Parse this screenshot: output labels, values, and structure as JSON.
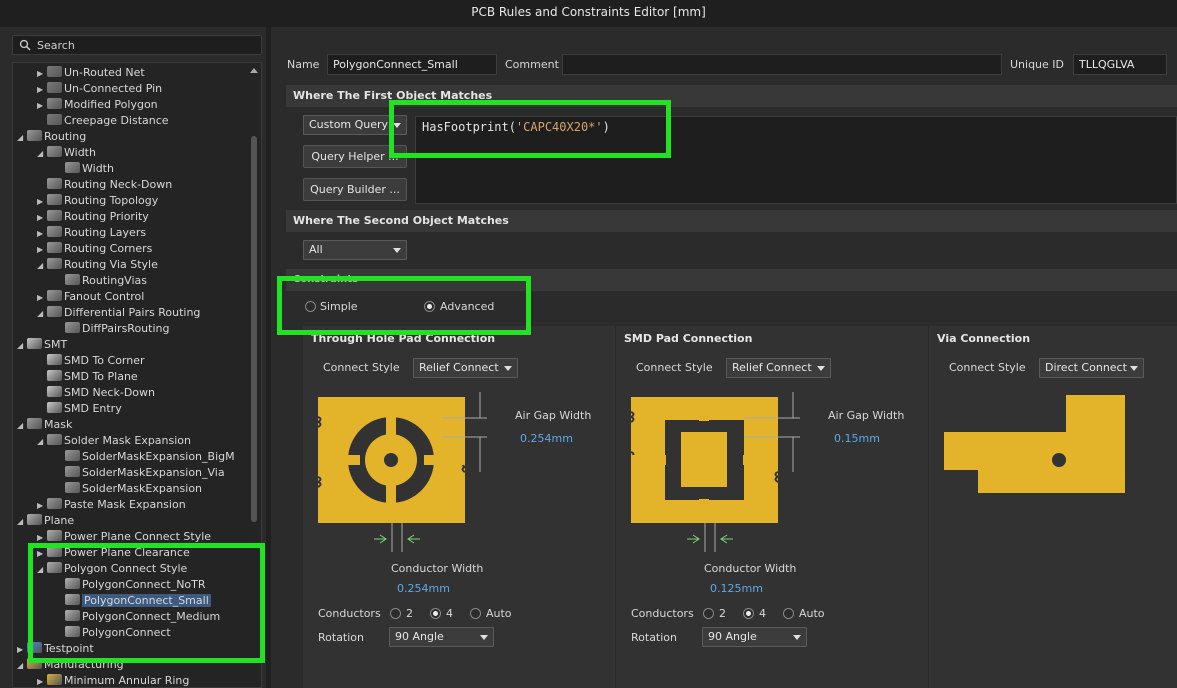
{
  "window": {
    "title": "PCB Rules and Constraints Editor [mm]"
  },
  "search": {
    "label": "Search"
  },
  "tree": {
    "items": [
      {
        "label": "Un-Routed Net",
        "arrow": "▶"
      },
      {
        "label": "Un-Connected Pin",
        "arrow": "▶"
      },
      {
        "label": "Modified Polygon",
        "arrow": "▶"
      },
      {
        "label": "Creepage Distance",
        "arrow": ""
      },
      {
        "label": "Routing",
        "arrow": "◢"
      },
      {
        "label": "Width",
        "arrow": "◢"
      },
      {
        "label": "Width",
        "arrow": ""
      },
      {
        "label": "Routing Neck-Down",
        "arrow": ""
      },
      {
        "label": "Routing Topology",
        "arrow": "▶"
      },
      {
        "label": "Routing Priority",
        "arrow": "▶"
      },
      {
        "label": "Routing Layers",
        "arrow": "▶"
      },
      {
        "label": "Routing Corners",
        "arrow": "▶"
      },
      {
        "label": "Routing Via Style",
        "arrow": "◢"
      },
      {
        "label": "RoutingVias",
        "arrow": ""
      },
      {
        "label": "Fanout Control",
        "arrow": "▶"
      },
      {
        "label": "Differential Pairs Routing",
        "arrow": "◢"
      },
      {
        "label": "DiffPairsRouting",
        "arrow": ""
      },
      {
        "label": "SMT",
        "arrow": "◢"
      },
      {
        "label": "SMD To Corner",
        "arrow": ""
      },
      {
        "label": "SMD To Plane",
        "arrow": ""
      },
      {
        "label": "SMD Neck-Down",
        "arrow": ""
      },
      {
        "label": "SMD Entry",
        "arrow": ""
      },
      {
        "label": "Mask",
        "arrow": "◢"
      },
      {
        "label": "Solder Mask Expansion",
        "arrow": "◢"
      },
      {
        "label": "SolderMaskExpansion_BigM",
        "arrow": ""
      },
      {
        "label": "SolderMaskExpansion_Via",
        "arrow": ""
      },
      {
        "label": "SolderMaskExpansion",
        "arrow": ""
      },
      {
        "label": "Paste Mask Expansion",
        "arrow": "▶"
      },
      {
        "label": "Plane",
        "arrow": "◢"
      },
      {
        "label": "Power Plane Connect Style",
        "arrow": "▶"
      },
      {
        "label": "Power Plane Clearance",
        "arrow": "▶"
      },
      {
        "label": "Polygon Connect Style",
        "arrow": "◢"
      },
      {
        "label": "PolygonConnect_NoTR",
        "arrow": ""
      },
      {
        "label": "PolygonConnect_Small",
        "arrow": ""
      },
      {
        "label": "PolygonConnect_Medium",
        "arrow": ""
      },
      {
        "label": "PolygonConnect",
        "arrow": ""
      },
      {
        "label": "Testpoint",
        "arrow": "▶"
      },
      {
        "label": "Manufacturing",
        "arrow": "◢"
      },
      {
        "label": "Minimum Annular Ring",
        "arrow": "▶"
      }
    ]
  },
  "header": {
    "name_label": "Name",
    "name_value": "PolygonConnect_Small",
    "comment_label": "Comment",
    "comment_value": "",
    "uid_label": "Unique ID",
    "uid_value": "TLLQGLVA"
  },
  "first_match": {
    "title": "Where The First Object Matches",
    "query_type": "Custom Query",
    "query_prefix": "HasFootprint(",
    "query_string": "'CAPC40X20*'",
    "query_suffix": ")",
    "query_helper": "Query Helper ...",
    "query_builder": "Query Builder ..."
  },
  "second_match": {
    "title": "Where The Second Object Matches",
    "selection": "All"
  },
  "constraints": {
    "title": "Constraints",
    "simple_label": "Simple",
    "advanced_label": "Advanced",
    "mode": "Advanced"
  },
  "through_hole": {
    "title": "Through Hole Pad Connection",
    "connect_style_label": "Connect Style",
    "connect_style": "Relief Connect",
    "air_gap_label": "Air Gap Width",
    "air_gap": "0.254mm",
    "conductor_width_label": "Conductor Width",
    "conductor_width": "0.254mm",
    "conductors_label": "Conductors",
    "conductor_options": [
      "2",
      "4",
      "Auto"
    ],
    "conductors_selected": "4",
    "rotation_label": "Rotation",
    "rotation": "90 Angle"
  },
  "smd": {
    "title": "SMD Pad Connection",
    "connect_style_label": "Connect Style",
    "connect_style": "Relief Connect",
    "air_gap_label": "Air Gap Width",
    "air_gap": "0.15mm",
    "conductor_width_label": "Conductor Width",
    "conductor_width": "0.125mm",
    "conductors_label": "Conductors",
    "conductor_options": [
      "2",
      "4",
      "Auto"
    ],
    "conductors_selected": "4",
    "rotation_label": "Rotation",
    "rotation": "90 Angle"
  },
  "via": {
    "title": "Via Connection",
    "connect_style_label": "Connect Style",
    "connect_style": "Direct Connect"
  },
  "colors": {
    "highlight": "#22e322",
    "copper": "#e3b42a",
    "value_blue": "#5fa8e8"
  }
}
